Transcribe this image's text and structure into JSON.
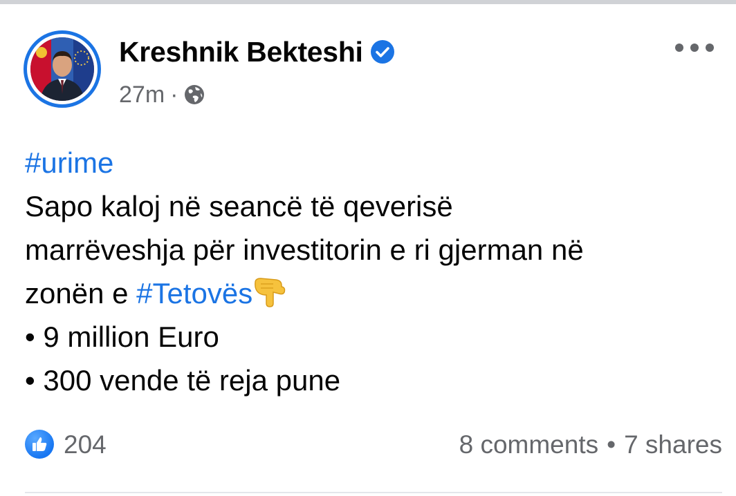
{
  "post": {
    "author": "Kreshnik Bekteshi",
    "verified_icon": "verified-badge-icon",
    "timestamp": "27m",
    "meta_separator": "·",
    "audience_icon": "globe-icon",
    "more_icon": "more-options-icon",
    "lines": [
      {
        "hashtag": "#urime"
      },
      {
        "text": "Sapo kaloj në seancë të qeverisë"
      },
      {
        "text": "marrëveshja për investitorin e ri gjerman në"
      },
      {
        "text": "zonën e ",
        "hashtag": "#Tetovës",
        "emoji": "👇"
      },
      {
        "text": "• 9 million Euro"
      },
      {
        "text": "• 300 vende të reja pune"
      }
    ]
  },
  "footer": {
    "reaction_icon": "like-icon",
    "reaction_count": "204",
    "comments": "8 comments",
    "separator": "•",
    "shares": "7 shares"
  },
  "colors": {
    "accent": "#1b74e4",
    "secondary_text": "#65676b",
    "primary_text": "#050505"
  }
}
